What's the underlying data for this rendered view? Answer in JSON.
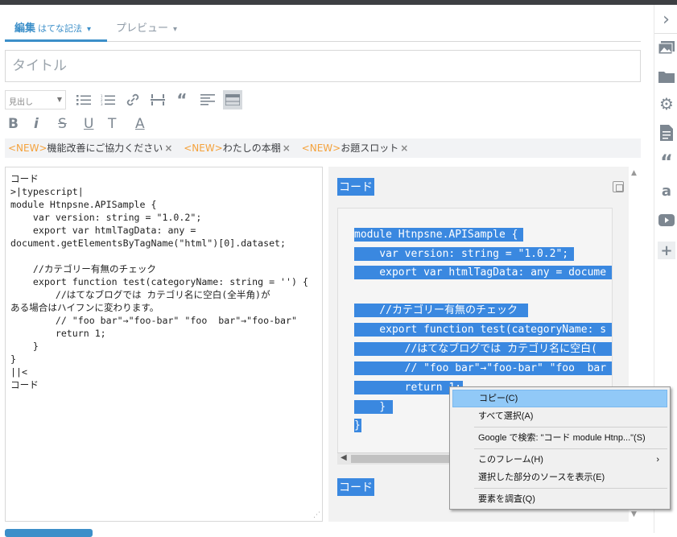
{
  "tabs": {
    "edit_label": "編集",
    "edit_sub": "はてな記法",
    "preview_label": "プレビュー"
  },
  "title_placeholder": "タイトル",
  "toolbar": {
    "heading_select": "見出し",
    "icons": [
      "bullet-list-icon",
      "numbered-list-icon",
      "link-icon",
      "horizontal-rule-icon",
      "quote-icon",
      "align-icon",
      "table-icon"
    ],
    "format": [
      "B",
      "i",
      "S",
      "U",
      "T",
      "A"
    ]
  },
  "notices": [
    {
      "tag": "<NEW>",
      "text": "機能改善にご協力ください"
    },
    {
      "tag": "<NEW>",
      "text": "わたしの本棚"
    },
    {
      "tag": "<NEW>",
      "text": "お題スロット"
    }
  ],
  "editor": {
    "lines": [
      "コード",
      ">|typescript|",
      "module Htnpsne.APISample {",
      "    var version: string = \"1.0.2\";",
      "    export var htmlTagData: any =",
      "document.getElementsByTagName(\"html\")[0].dataset;",
      "",
      "    //カテゴリー有無のチェック",
      "    export function test(categoryName: string = '') {",
      "        //はてなブログでは カテゴリ名に空白(全半角)が",
      "ある場合はハイフンに変わります。",
      "        // \"foo bar\"→\"foo-bar\" \"foo  bar\"→\"foo-bar\"",
      "        return 1;",
      "    }",
      "}",
      "||<",
      "コード"
    ]
  },
  "preview": {
    "heading_top": "コード",
    "heading_bottom": "コード",
    "code_lines": [
      "module Htnpsne.APISample {",
      "    var version: string = \"1.0.2\";",
      "    export var htmlTagData: any = docume",
      "",
      "    //カテゴリー有無のチェック",
      "    export function test(categoryName: s",
      "        //はてなブログでは カテゴリ名に空白(",
      "        // \"foo bar\"→\"foo-bar\" \"foo  bar",
      "        return 1;",
      "    }",
      "}"
    ]
  },
  "context_menu": {
    "items": [
      "コピー(C)",
      "すべて選択(A)",
      "Google で検索: \"コード module Htnp...\"(S)",
      "このフレーム(H)",
      "選択した部分のソースを表示(E)",
      "要素を調査(Q)"
    ],
    "submenu_arrow": "›"
  },
  "sidebar_icons": [
    "collapse-chevron-icon",
    "image-icon",
    "folder-icon",
    "gear-icon",
    "document-icon",
    "quote-icon",
    "amazon-icon",
    "youtube-icon",
    "plus-icon"
  ],
  "colors": {
    "accent": "#3c8fc9",
    "selection": "#3a88e0",
    "new_tag": "#f4a23c",
    "menu_highlight": "#91c9f7"
  }
}
